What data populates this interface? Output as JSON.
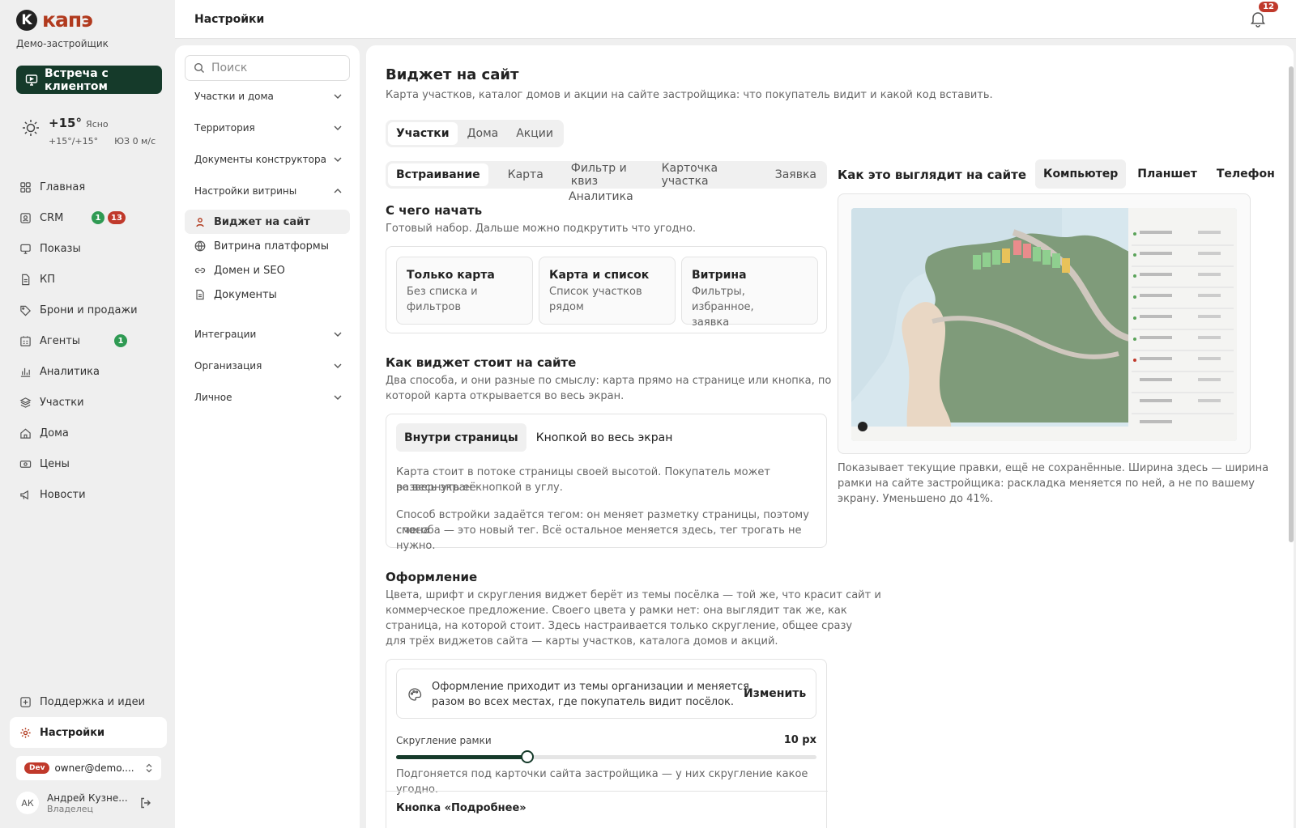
{
  "brand": {
    "logo_letter": "K",
    "name": "капэ",
    "org": "Демо-застройщик"
  },
  "meeting_button": "Встреча с клиентом",
  "weather": {
    "temp": "+15°",
    "cond": "Ясно",
    "range": "+15°/+15°",
    "wind": "ЮЗ 0 м/с"
  },
  "nav": [
    {
      "label": "Главная",
      "icon": "home-grid-icon"
    },
    {
      "label": "CRM",
      "icon": "crm-icon",
      "badges": [
        "1",
        "13"
      ]
    },
    {
      "label": "Показы",
      "icon": "monitor-icon"
    },
    {
      "label": "КП",
      "icon": "document-icon"
    },
    {
      "label": "Брони и продажи",
      "icon": "tag-icon"
    },
    {
      "label": "Агенты",
      "icon": "agents-icon",
      "badges": [
        "1"
      ]
    },
    {
      "label": "Аналитика",
      "icon": "chart-icon"
    },
    {
      "label": "Участки",
      "icon": "plots-icon"
    },
    {
      "label": "Дома",
      "icon": "house-icon"
    },
    {
      "label": "Цены",
      "icon": "price-icon"
    },
    {
      "label": "Новости",
      "icon": "megaphone-icon"
    }
  ],
  "nav_bottom": {
    "support": "Поддержка и идеи",
    "settings": "Настройки"
  },
  "account": {
    "env": "Dev",
    "email": "owner@demo...."
  },
  "user": {
    "initials": "АК",
    "name": "Андрей Кузне...",
    "role": "Владелец"
  },
  "header": {
    "title": "Настройки",
    "notifications": "12"
  },
  "settings_menu": {
    "search_placeholder": "Поиск",
    "groups": {
      "plots": "Участки и дома",
      "territory": "Территория",
      "docs": "Документы конструктора",
      "showcase": "Настройки витрины",
      "integrations": "Интеграции",
      "organization": "Организация",
      "personal": "Личное"
    },
    "sub": {
      "widget": "Виджет на сайт",
      "platform": "Витрина платформы",
      "domain": "Домен и SEO",
      "documents": "Документы"
    }
  },
  "main": {
    "title": "Виджет на сайт",
    "subtitle": "Карта участков, каталог домов и акции на сайте застройщика: что покупатель видит и какой код вставить.",
    "entity_tabs": [
      "Участки",
      "Дома",
      "Акции"
    ],
    "sub_tabs": [
      "Встраивание",
      "Карта",
      "Фильтр и квиз",
      "Карточка участка",
      "Заявка"
    ],
    "sub_tab_extra": "Аналитика",
    "start": {
      "title": "С чего начать",
      "desc": "Готовый набор. Дальше можно подкрутить что угодно.",
      "presets": [
        {
          "title": "Только карта",
          "desc1": "Без списка и",
          "desc2": "фильтров"
        },
        {
          "title": "Карта и список",
          "desc1": "Список участков",
          "desc2": "рядом"
        },
        {
          "title": "Витрина",
          "desc1": "Фильтры, избранное,",
          "desc2": "заявка"
        }
      ]
    },
    "placement": {
      "title": "Как виджет стоит на сайте",
      "desc1": "Два способа, и они разные по смыслу: карта прямо на странице или кнопка, по",
      "desc2": "которой карта открывается во весь экран.",
      "tabs": [
        "Внутри страницы",
        "Кнопкой во весь экран"
      ],
      "p1a": "Карта стоит в потоке страницы своей высотой. Покупатель может развернуть её",
      "p1b": "во весь экран кнопкой в углу.",
      "p2a": "Способ встройки задаётся тегом: он меняет разметку страницы, поэтому смена",
      "p2b": "способа — это новый тег. Всё остальное меняется здесь, тег трогать не нужно."
    },
    "design": {
      "title": "Оформление",
      "d1": "Цвета, шрифт и скругления виджет берёт из темы посёлка — той же, что красит сайт и",
      "d2": "коммерческое предложение. Своего цвета у рамки нет: она выглядит так же, как",
      "d3": "страница, на которой стоит. Здесь настраивается только скругление, общее сразу",
      "d4": "для трёх виджетов сайта — карты участков, каталога домов и акций.",
      "theme1": "Оформление приходит из темы организации и меняется",
      "theme2": "разом во всех местах, где покупатель видит посёлок.",
      "change": "Изменить",
      "radius_label": "Скругление рамки",
      "radius_value": "10 px",
      "radius_px": 10,
      "radius_max": 32,
      "radius_hint": "Подгоняется под карточки сайта застройщика — у них скругление какое угодно.",
      "more_button": "Кнопка «Подробнее»"
    },
    "preview": {
      "title": "Как это выглядит на сайте",
      "devices": [
        "Компьютер",
        "Планшет",
        "Телефон"
      ],
      "n1": "Показывает текущие правки, ещё не сохранённые. Ширина здесь — ширина",
      "n2": "рамки на сайте застройщика: раскладка меняется по ней, а не по вашему",
      "n3": "экрану. Уменьшено до 41%."
    }
  },
  "colors": {
    "accent": "#153a2a",
    "badge_red": "#c0392b",
    "badge_green": "#2f9a53"
  }
}
